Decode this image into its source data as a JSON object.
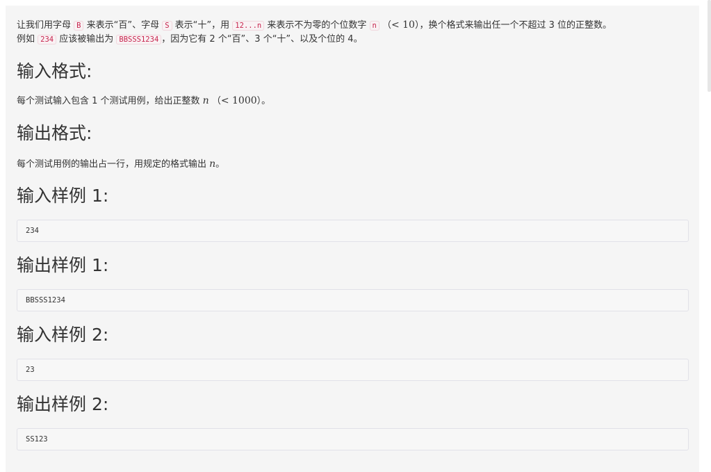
{
  "problem": {
    "desc_p1_a": "让我们用字母 ",
    "code_B": "B",
    "desc_p1_b": " 来表示“百”、字母 ",
    "code_S": "S",
    "desc_p1_c": " 表示“十”，用 ",
    "code_seq": "12...n",
    "desc_p1_d": " 来表示不为零的个位数字 ",
    "code_n": "n",
    "desc_p1_e": " （",
    "math_lt10": "< 10",
    "desc_p1_f": "），换个格式来输出任一个不超过 3 位的正整数。",
    "desc_p2_a": "例如 ",
    "code_234": "234",
    "desc_p2_b": " 应该被输出为 ",
    "code_out": "BBSSS1234",
    "desc_p2_c": "，因为它有 2 个“百”、3 个“十”、以及个位的 4。"
  },
  "input_format": {
    "title": "输入格式:",
    "text_a": "每个测试输入包含 1 个测试用例，给出正整数 ",
    "math_n": "n",
    "text_b": " （",
    "math_lt1000": "< 1000",
    "text_c": "）。"
  },
  "output_format": {
    "title": "输出格式:",
    "text_a": "每个测试用例的输出占一行，用规定的格式输出 ",
    "math_n": "n",
    "text_b": "。"
  },
  "samples": [
    {
      "title": "输入样例 1:",
      "value": "234"
    },
    {
      "title": "输出样例 1:",
      "value": "BBSSS1234"
    },
    {
      "title": "输入样例 2:",
      "value": "23"
    },
    {
      "title": "输出样例 2:",
      "value": "SS123"
    }
  ],
  "colors": {
    "panel_bg": "#f5f5f5",
    "code_text": "#c7254e",
    "code_bg": "#f9f2f4"
  }
}
